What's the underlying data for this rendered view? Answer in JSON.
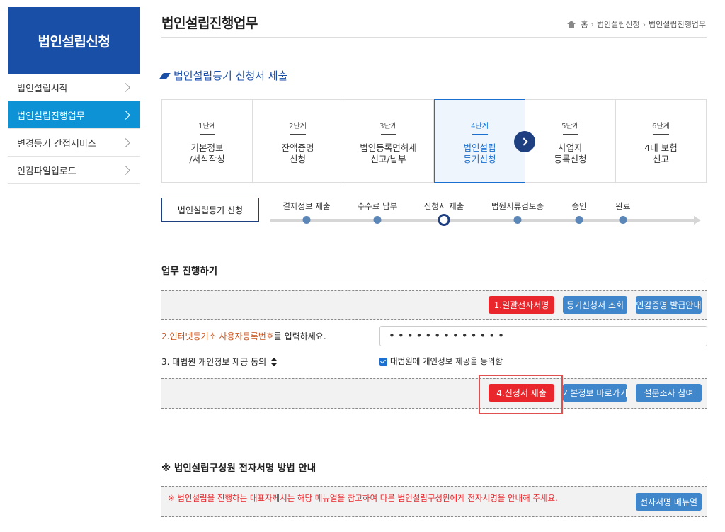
{
  "sidebar": {
    "title": "법인설립신청",
    "items": [
      {
        "label": "법인설립시작"
      },
      {
        "label": "법인설립진행업무"
      },
      {
        "label": "변경등기 간접서비스"
      },
      {
        "label": "인감파일업로드"
      }
    ]
  },
  "header": {
    "title": "법인설립진행업무",
    "breadcrumb": [
      "홈",
      "법인설립신청",
      "법인설립진행업무"
    ]
  },
  "section_title": "법인설립등기 신청서 제출",
  "steps": [
    {
      "no": "1단계",
      "label_line1": "기본정보",
      "label_line2": "/서식작성"
    },
    {
      "no": "2단계",
      "label_line1": "잔액증명",
      "label_line2": "신청"
    },
    {
      "no": "3단계",
      "label_line1": "법인등록면허세",
      "label_line2": "신고/납부"
    },
    {
      "no": "4단계",
      "label_line1": "법인설립",
      "label_line2": "등기신청"
    },
    {
      "no": "5단계",
      "label_line1": "사업자",
      "label_line2": "등록신청"
    },
    {
      "no": "6단계",
      "label_line1": "4대 보험",
      "label_line2": "신고"
    }
  ],
  "progress": {
    "box_label": "법인설립등기 신청",
    "stages": [
      "결제정보 제출",
      "수수료 납부",
      "신청서 제출",
      "법원서류검토중",
      "승인",
      "완료"
    ],
    "current_stage": "신청서 제출"
  },
  "work": {
    "title": "업무 진행하기",
    "buttons_top": [
      "1.일괄전자서명",
      "등기신청서 조회",
      "인감증명 발급안내"
    ],
    "field_label_highlight": "2.인터넷등기소 사용자등록번호",
    "field_label_rest": "를 입력하세요.",
    "password_value": "•••••••••••••",
    "consent_label": "3. 대법원 개인정보 제공 동의",
    "consent_check_label": "대법원에 개인정보 제공을 동의함",
    "consent_checked": true,
    "buttons_bottom": [
      "4.신청서 제출",
      "기본정보 바로가기",
      "설문조사 참여"
    ]
  },
  "guide": {
    "title": "※ 법인설립구성원 전자서명 방법 안내",
    "text": "※ 법인설립을 진행하는 대표자께서는 해당 메뉴얼을 참고하여 다른 법인설립구성원에게 전자서명을 안내해 주세요.",
    "button": "전자서명 메뉴얼"
  },
  "colors": {
    "brand": "#1a4fa8",
    "active_nav": "#0d92d6",
    "red_button": "#e8262b",
    "blue_button": "#3f86cb"
  }
}
